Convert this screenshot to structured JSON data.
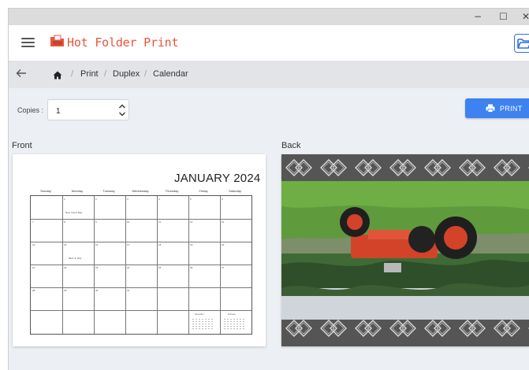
{
  "window": {
    "controls": {
      "minimize": "−",
      "maximize": "☐",
      "close": "✕"
    }
  },
  "app": {
    "title": "Hot Folder Print",
    "brand_color": "#e8553f",
    "accent_color": "#3d82f0"
  },
  "icons": {
    "menu": "hamburger-icon",
    "logo": "folder-print-logo-icon",
    "open_folder": "folder-open-icon",
    "back": "arrow-left-icon",
    "home": "home-icon",
    "stepper": "chevron-up-down-icon",
    "print": "printer-icon"
  },
  "breadcrumb": {
    "items": [
      "Print",
      "Duplex",
      "Calendar"
    ],
    "separator": "/"
  },
  "copies": {
    "label": "Copies :",
    "value": "1"
  },
  "print_button": {
    "label": "PRINT"
  },
  "preview": {
    "front_label": "Front",
    "back_label": "Back",
    "calendar": {
      "title": "JANUARY 2024",
      "weekdays": [
        "Sunday",
        "Monday",
        "Tuesday",
        "Wednesday",
        "Thursday",
        "Friday",
        "Saturday"
      ],
      "weeks": [
        [
          "",
          "1",
          "2",
          "3",
          "4",
          "5",
          "6"
        ],
        [
          "7",
          "8",
          "9",
          "10",
          "11",
          "12",
          "13"
        ],
        [
          "14",
          "15",
          "16",
          "17",
          "18",
          "19",
          "20"
        ],
        [
          "21",
          "22",
          "23",
          "24",
          "25",
          "26",
          "27"
        ],
        [
          "28",
          "29",
          "30",
          "31",
          "",
          "",
          ""
        ],
        [
          "",
          "",
          "",
          "",
          "",
          "",
          ""
        ]
      ],
      "holidays": [
        {
          "day": "1",
          "text": "New Year's Day"
        },
        {
          "day": "15",
          "text": "MLK Jr. Day"
        }
      ],
      "mini_months": [
        "December",
        "February"
      ]
    },
    "back_image": {
      "subject": "red vintage tractor photo, upside down",
      "border_pattern": "interlocking diamond knots"
    }
  }
}
